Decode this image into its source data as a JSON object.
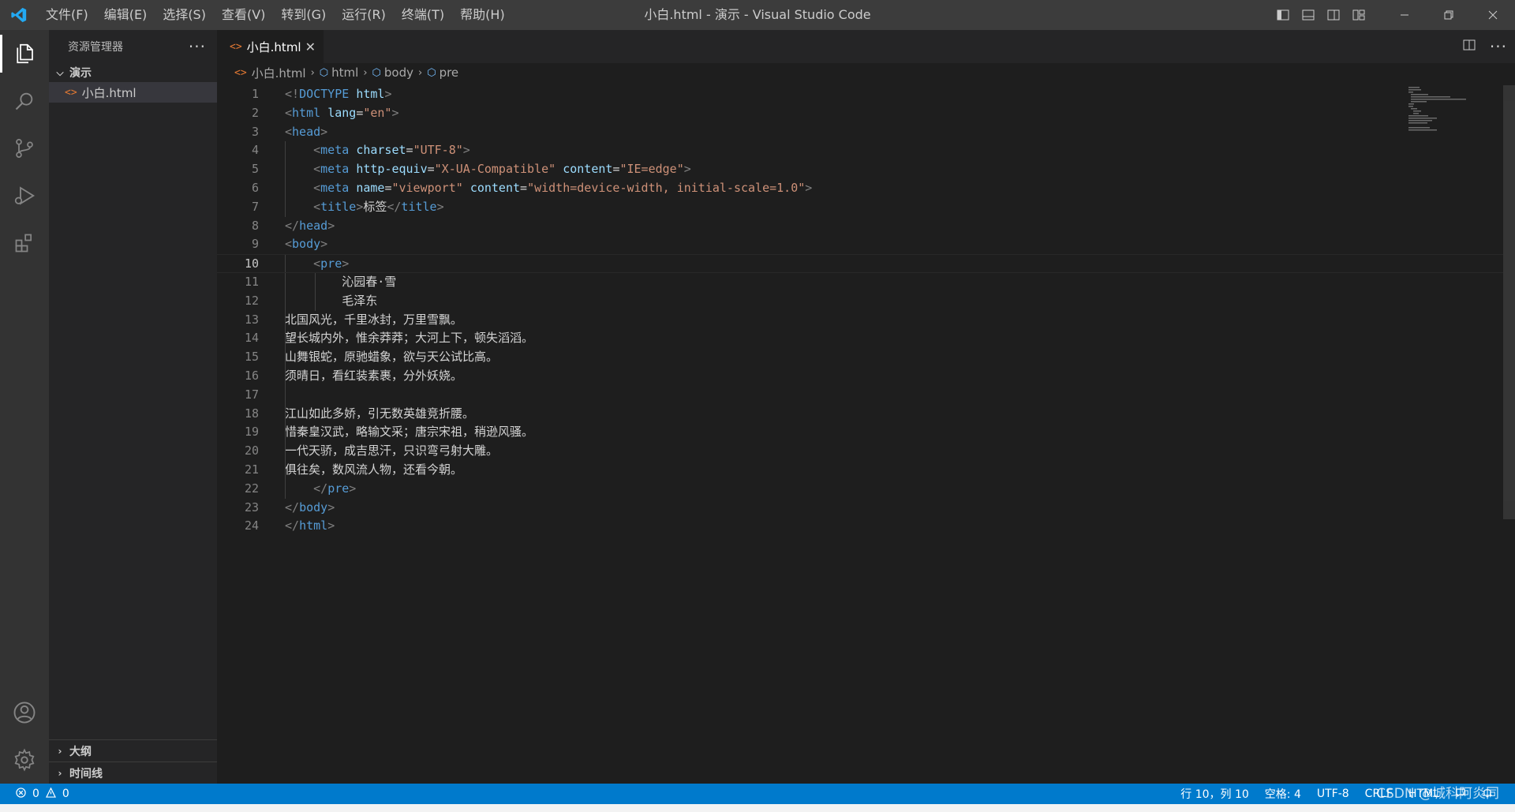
{
  "window": {
    "title": "小白.html - 演示 - Visual Studio Code",
    "menu": [
      "文件(F)",
      "编辑(E)",
      "选择(S)",
      "查看(V)",
      "转到(G)",
      "运行(R)",
      "终端(T)",
      "帮助(H)"
    ]
  },
  "colors": {
    "accent": "#007acc",
    "tag": "#569cd6",
    "attr": "#9cdcfe",
    "string": "#ce9178",
    "punct": "#808080",
    "text": "#d4d4d4"
  },
  "sidebar": {
    "title": "资源管理器",
    "more": "···",
    "folder": "演示",
    "file": "小白.html",
    "sections": [
      "大纲",
      "时间线"
    ]
  },
  "tab": {
    "label": "小白.html",
    "close": "✕"
  },
  "breadcrumb": {
    "file": "小白.html",
    "items": [
      "html",
      "body",
      "pre"
    ]
  },
  "editor": {
    "current_line": 10,
    "lines": [
      {
        "n": "1",
        "t": "<!DOCTYPE html>"
      },
      {
        "n": "2",
        "t": "<html lang=\"en\">"
      },
      {
        "n": "3",
        "t": "<head>"
      },
      {
        "n": "4",
        "t": "    <meta charset=\"UTF-8\">"
      },
      {
        "n": "5",
        "t": "    <meta http-equiv=\"X-UA-Compatible\" content=\"IE=edge\">"
      },
      {
        "n": "6",
        "t": "    <meta name=\"viewport\" content=\"width=device-width, initial-scale=1.0\">"
      },
      {
        "n": "7",
        "t": "    <title>标签</title>"
      },
      {
        "n": "8",
        "t": "</head>"
      },
      {
        "n": "9",
        "t": "<body>"
      },
      {
        "n": "10",
        "t": "    <pre>"
      },
      {
        "n": "11",
        "t": "        沁园春·雪"
      },
      {
        "n": "12",
        "t": "        毛泽东"
      },
      {
        "n": "13",
        "t": "北国风光，千里冰封，万里雪飘。"
      },
      {
        "n": "14",
        "t": "望长城内外，惟余莽莽；大河上下，顿失滔滔。"
      },
      {
        "n": "15",
        "t": "山舞银蛇，原驰蜡象，欲与天公试比高。"
      },
      {
        "n": "16",
        "t": "须晴日，看红装素裹，分外妖娆。"
      },
      {
        "n": "17",
        "t": ""
      },
      {
        "n": "18",
        "t": "江山如此多娇，引无数英雄竞折腰。"
      },
      {
        "n": "19",
        "t": "惜秦皇汉武，略输文采；唐宗宋祖，稍逊风骚。"
      },
      {
        "n": "20",
        "t": "一代天骄，成吉思汗，只识弯弓射大雕。"
      },
      {
        "n": "21",
        "t": "俱往矣，数风流人物，还看今朝。"
      },
      {
        "n": "22",
        "t": "    </pre>"
      },
      {
        "n": "23",
        "t": "</body>"
      },
      {
        "n": "24",
        "t": "</html>"
      }
    ]
  },
  "status": {
    "errors": "0",
    "warnings": "0",
    "position": "行 10，列 10",
    "spaces": "空格: 4",
    "encoding": "UTF-8",
    "eol": "CRLF",
    "language": "HTML",
    "watermark": "CSDN @城科阿炎同"
  }
}
